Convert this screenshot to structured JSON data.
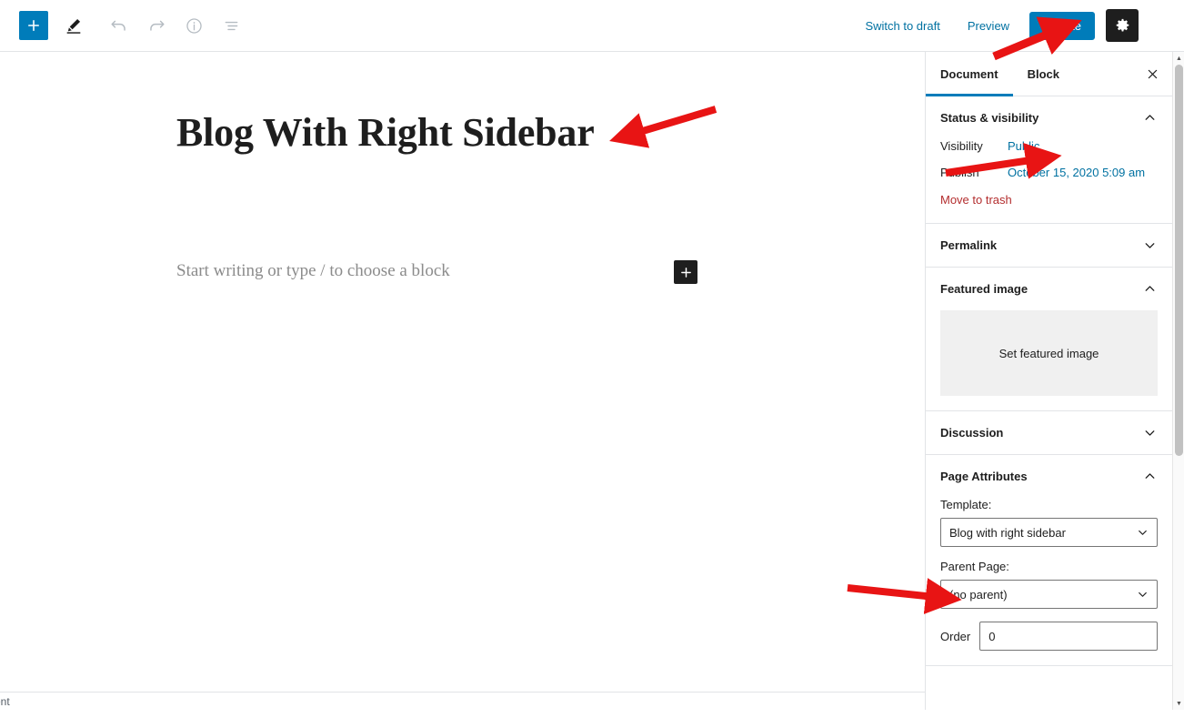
{
  "toolbar": {
    "add_block_label": "+",
    "tools_icon": "pencil-icon",
    "undo_icon": "undo-icon",
    "redo_icon": "redo-icon",
    "info_icon": "info-icon",
    "list_view_icon": "list-view-icon",
    "switch_to_draft": "Switch to draft",
    "preview": "Preview",
    "update": "Update",
    "settings_icon": "gear-icon",
    "more_icon": "kebab-menu-icon"
  },
  "editor": {
    "post_title": "Blog With Right Sidebar",
    "block_placeholder": "Start writing or type / to choose a block",
    "inserter_label": "+"
  },
  "sidebar": {
    "tabs": [
      {
        "label": "Document",
        "active": true
      },
      {
        "label": "Block",
        "active": false
      }
    ],
    "close_label": "×",
    "panels": [
      {
        "title": "Status & visibility",
        "expanded": true,
        "rows": [
          {
            "label": "Visibility",
            "value": "Public"
          },
          {
            "label": "Publish",
            "value": "October 15, 2020 5:09 am"
          }
        ],
        "trash_label": "Move to trash"
      },
      {
        "title": "Permalink",
        "expanded": false
      },
      {
        "title": "Featured image",
        "expanded": true,
        "set_image_label": "Set featured image"
      },
      {
        "title": "Discussion",
        "expanded": false
      },
      {
        "title": "Page Attributes",
        "expanded": true,
        "template_label": "Template:",
        "template_value": "Blog with right sidebar",
        "parent_label": "Parent Page:",
        "parent_value": "(no parent)",
        "order_label": "Order",
        "order_value": "0"
      }
    ]
  },
  "statusbar": {
    "breadcrumb": "Document"
  },
  "colors": {
    "accent_blue": "#007cba",
    "link_blue": "#0071a1",
    "trash_red": "#b32d2e",
    "annotation_red": "#e81414",
    "dark": "#1e1e1e"
  },
  "annotations": [
    {
      "name": "arrow-to-update-button",
      "target": "Update"
    },
    {
      "name": "arrow-to-post-title",
      "target": "Blog With Right Sidebar"
    },
    {
      "name": "arrow-to-visibility-public",
      "target": "Public"
    },
    {
      "name": "arrow-to-template-select",
      "target": "Blog with right sidebar"
    }
  ]
}
